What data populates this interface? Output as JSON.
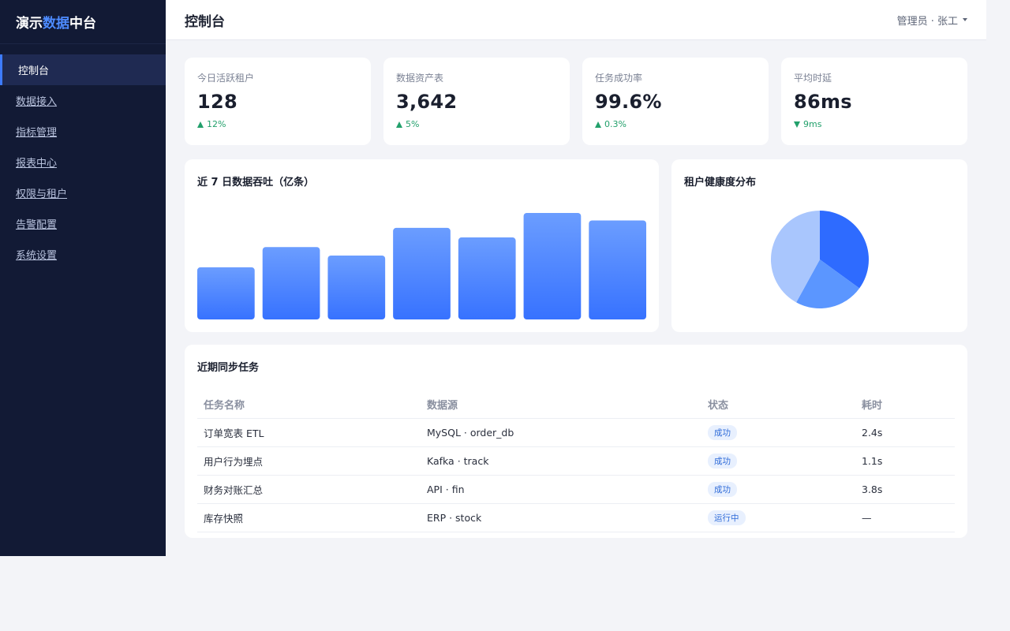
{
  "brand": {
    "part1": "演示",
    "part2": "数据",
    "part3": "中台"
  },
  "sidebar": {
    "items": [
      {
        "label": "控制台",
        "active": true
      },
      {
        "label": "数据接入"
      },
      {
        "label": "指标管理"
      },
      {
        "label": "报表中心"
      },
      {
        "label": "权限与租户"
      },
      {
        "label": "告警配置"
      },
      {
        "label": "系统设置"
      }
    ]
  },
  "header": {
    "title": "控制台",
    "user": "管理员 · 张工"
  },
  "stats": [
    {
      "label": "今日活跃租户",
      "value": "128",
      "trend": "12%",
      "direction": "up"
    },
    {
      "label": "数据资产表",
      "value": "3,642",
      "trend": "5%",
      "direction": "up"
    },
    {
      "label": "任务成功率",
      "value": "99.6%",
      "trend": "0.3%",
      "direction": "up"
    },
    {
      "label": "平均时延",
      "value": "86ms",
      "trend": "9ms",
      "direction": "down"
    }
  ],
  "colors": {
    "accent": "#3d7bff",
    "positive": "#22a06b",
    "sidebar_bg": "#121a35"
  },
  "chart_data": [
    {
      "type": "bar",
      "title": "近 7 日数据吞吐（亿条）",
      "categories": [],
      "values": [
        4.9,
        6.8,
        6.0,
        8.6,
        7.7,
        10.0,
        9.3
      ],
      "ylim": [
        0,
        10
      ],
      "grid": false,
      "gradient": [
        "#6b9dff",
        "#3772ff"
      ]
    },
    {
      "type": "pie",
      "title": "租户健康度分布",
      "slices": [
        {
          "value": 35,
          "color": "#2e6bff"
        },
        {
          "value": 23,
          "color": "#5b96ff"
        },
        {
          "value": 42,
          "color": "#a9c6fd"
        }
      ]
    }
  ],
  "table": {
    "title": "近期同步任务",
    "columns": [
      "任务名称",
      "数据源",
      "状态",
      "耗时"
    ],
    "rows": [
      [
        "订单宽表 ETL",
        "MySQL · order_db",
        "成功",
        "2.4s"
      ],
      [
        "用户行为埋点",
        "Kafka · track",
        "成功",
        "1.1s"
      ],
      [
        "财务对账汇总",
        "API · fin",
        "成功",
        "3.8s"
      ],
      [
        "库存快照",
        "ERP · stock",
        "运行中",
        "—"
      ]
    ]
  }
}
